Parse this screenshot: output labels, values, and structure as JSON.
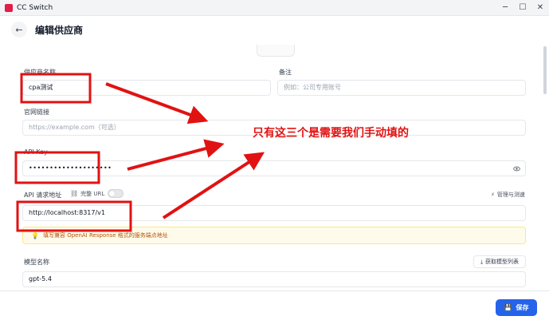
{
  "window": {
    "title": "CC Switch",
    "controls": {
      "minimize": "─",
      "maximize": "☐",
      "close": "✕"
    }
  },
  "header": {
    "back_icon": "←",
    "title": "编辑供应商"
  },
  "form": {
    "provider_name": {
      "label": "供应商名称",
      "value": "cpa测试"
    },
    "note": {
      "label": "备注",
      "placeholder": "例如：公司专用账号"
    },
    "website": {
      "label": "官网链接",
      "placeholder": "https://example.com（可选）"
    },
    "api_key": {
      "label": "API Key",
      "value": "••••••••••••••••••••"
    },
    "api_url": {
      "label": "API 请求地址",
      "full_url_toggle_label": "完整 URL",
      "full_url_enabled": false,
      "manage_label": "管理与测速",
      "value": "http://localhost:8317/v1",
      "hint": "填写兼容 OpenAI Response 格式的服务端点地址"
    },
    "model": {
      "label": "模型名称",
      "fetch_button": "获取模型列表",
      "value": "gpt-5.4"
    }
  },
  "footer": {
    "save_label": "保存"
  },
  "annotation": {
    "text": "只有这三个是需要我们手动填的",
    "color": "#e11212"
  },
  "colors": {
    "accent": "#2563eb",
    "warning_bg": "#fffbeb",
    "warning_text": "#b45309",
    "annotation_red": "#e11212"
  }
}
